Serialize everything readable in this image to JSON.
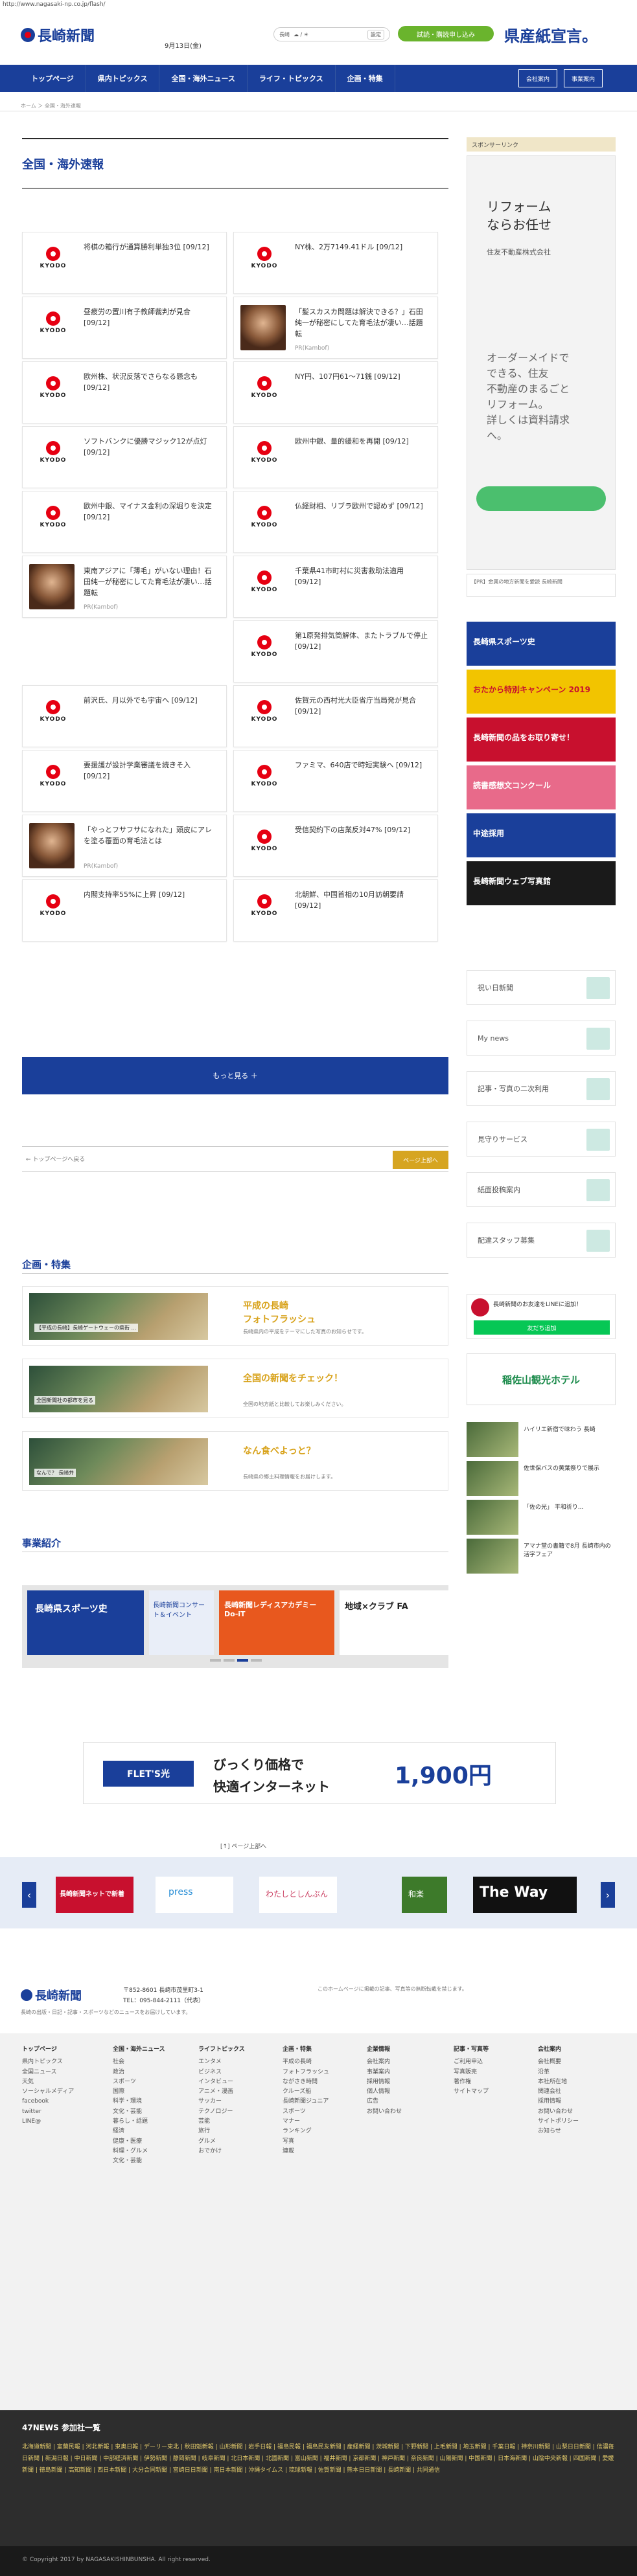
{
  "browser": {
    "url": "http://www.nagasaki-np.co.jp/flash/"
  },
  "header": {
    "logo_text": "長崎新聞",
    "date": "9月13日(金)",
    "weather": "長崎",
    "weather_btn": "設定",
    "trial_btn": "試読・購読申し込み",
    "ken": "県産紙宣言。"
  },
  "nav": {
    "items": [
      "トップページ",
      "県内トピックス",
      "全国・海外ニュース",
      "ライフ・トピックス",
      "企画・特集"
    ],
    "right": [
      "会社案内",
      "事業案内"
    ]
  },
  "breadcrumb": "ホーム ＞ 全国・海外速報",
  "page_title": "全国・海外速報",
  "cards": [
    {
      "text": "将棋の箱行が通算勝利単独3位 [09/12]",
      "type": "kyodo"
    },
    {
      "text": "NY株、2万7149.41ドル [09/12]",
      "type": "kyodo"
    },
    {
      "text": "昼疲労の置川有子教師裁判が見合 [09/12]",
      "type": "kyodo"
    },
    {
      "text": "「髪スカスカ問題は解決できる？」石田純一が秘密にしてた育毛法が凄い…話題転",
      "type": "photo",
      "pr": "PR(Kambof)"
    },
    {
      "text": "欧州株、状況反落でさらなる懸念も [09/12]",
      "type": "kyodo"
    },
    {
      "text": "NY円、107円61〜71銭 [09/12]",
      "type": "kyodo"
    },
    {
      "text": "ソフトバンクに優勝マジック12が点灯 [09/12]",
      "type": "kyodo"
    },
    {
      "text": "欧州中銀、量的緩和を再開 [09/12]",
      "type": "kyodo"
    },
    {
      "text": "欧州中銀、マイナス金利の深堀りを決定 [09/12]",
      "type": "kyodo"
    },
    {
      "text": "仏経財相、リブラ欧州で認めず [09/12]",
      "type": "kyodo"
    },
    {
      "text": "東南アジアに「薄毛」がいない理由！石田純一が秘密にしてた育毛法が凄い…話題転",
      "type": "photo",
      "pr": "PR(Kambof)"
    },
    {
      "text": "千葉県41市町村に災害救助法適用 [09/12]",
      "type": "kyodo"
    },
    {
      "text": "",
      "type": "empty"
    },
    {
      "text": "第1原発排気筒解体、またトラブルで停止 [09/12]",
      "type": "kyodo"
    },
    {
      "text": "前沢氏、月以外でも宇宙へ [09/12]",
      "type": "kyodo"
    },
    {
      "text": "佐賀元の西村光大臣省庁当局発が見合 [09/12]",
      "type": "kyodo"
    },
    {
      "text": "要援護が設計学業審議を続きそ入 [09/12]",
      "type": "kyodo"
    },
    {
      "text": "ファミマ、640店で時短実験へ [09/12]",
      "type": "kyodo"
    },
    {
      "text": "「やっとフサフサになれた」頭皮にアレを塗る覆面の育毛法とは",
      "type": "photo",
      "pr": "PR(Kambof)"
    },
    {
      "text": "受信契約下の店業反対47% [09/12]",
      "type": "kyodo"
    },
    {
      "text": "内閣支持率55%に上昇 [09/12]",
      "type": "kyodo"
    },
    {
      "text": "北朝鮮、中国首相の10月訪朝要請 [09/12]",
      "type": "kyodo"
    }
  ],
  "kyodo_label": "KYODO",
  "more_button": "もっと見る ＋",
  "pager": {
    "back": "← トップページへ戻る",
    "top": "ページ上部へ"
  },
  "tokushu": {
    "title": "企画・特集",
    "items": [
      {
        "caption": "【平成の長崎】長崎ゲートウェーの県街 ...",
        "head": "平成の長崎\nフォトフラッシュ",
        "desc": "長崎県内の平成をテーマにした写真のお知らせです。"
      },
      {
        "caption": "全国新聞社の都市を見る",
        "head": "全国の新聞をチェック！",
        "desc": "全国の地方紙と比較してお楽しみください。"
      },
      {
        "caption": "なんで？ 長崎弁",
        "head": "なん食べよっと？",
        "desc": "長崎県の郷土料理情報をお届けします。"
      }
    ]
  },
  "jigyo": {
    "title": "事業紹介",
    "banners": [
      "長崎県スポーツ史",
      "長崎新聞コンサート＆イベント",
      "長崎新聞レディスアカデミー Do-iT",
      "地域×クラブ FA"
    ]
  },
  "ad_banner": {
    "left": "FLET'S光",
    "right_1": "びっくり価格で",
    "right_2": "快適インターネット",
    "price": "1,900円"
  },
  "fix_label": "[↑] ページ上部へ",
  "strip_banners": [
    "長崎新聞ネットで新着",
    "press",
    "わたしとしんぶん",
    "和楽",
    "The Way"
  ],
  "footer": {
    "address": "〒852-8601 長崎市茂里町3-1",
    "tel": "TEL：095-844-2111（代表）",
    "note": "長崎の出版・日記・記事・スポーツなどのニュースをお届けしています。",
    "policy": "このホームページに掲載の記事、写真等の無断転載を禁じます。",
    "cols": [
      {
        "head": "トップページ",
        "items": [
          "県内トピックス",
          "全国ニュース",
          "天気",
          "ソーシャルメディア",
          "facebook",
          "twitter",
          "LINE@"
        ]
      },
      {
        "head": "全国・海外ニュース",
        "items": [
          "社会",
          "政治",
          "スポーツ",
          "国際",
          "科学・環境",
          "文化・芸能",
          "暮らし・話題",
          "経済",
          "健康・医療",
          "料理・グルメ",
          "文化・芸能"
        ]
      },
      {
        "head": "ライフトピックス",
        "items": [
          "エンタメ",
          "ビジネス",
          "インタビュー",
          "アニメ・漫画",
          "サッカー",
          "テクノロジー",
          "芸能",
          "旅行",
          "グルメ",
          "おでかけ"
        ]
      },
      {
        "head": "企画・特集",
        "items": [
          "平成の長崎",
          "フォトフラッシュ",
          "ながさき時間",
          "クルーズ船",
          "長崎新聞ジュニア",
          "スポーツ",
          "マナー",
          "ランキング",
          "写真",
          "連載"
        ]
      },
      {
        "head": "企業情報",
        "items": [
          "会社案内",
          "事業案内",
          "採用情報",
          "個人情報",
          "広告",
          "お問い合わせ"
        ]
      },
      {
        "head": "記事・写真等",
        "items": [
          "ご利用申込",
          "写真販売",
          "著作権",
          "サイトマップ"
        ]
      },
      {
        "head": "会社案内",
        "items": [
          "会社概要",
          "沿革",
          "本社所在地",
          "関連会社",
          "採用情報",
          "お問い合わせ",
          "サイトポリシー",
          "お知らせ"
        ]
      }
    ]
  },
  "n47": {
    "title": "47NEWS 参加社一覧",
    "links": "北海道新聞 | 室蘭民報 | 河北新報 | 東奥日報 | デーリー東北 | 秋田魁新報 | 山形新聞 | 岩手日報 | 福島民報 | 福島民友新聞 | 産経新聞 | 茨城新聞 | 下野新聞 | 上毛新聞 | 埼玉新聞 | 千葉日報 | 神奈川新聞 | 山梨日日新聞 | 信濃毎日新聞 | 新潟日報 | 中日新聞 | 中部経済新聞 | 伊勢新聞 | 静岡新聞 | 岐阜新聞 | 北日本新聞 | 北國新聞 | 富山新聞 | 福井新聞 | 京都新聞 | 神戸新聞 | 奈良新聞 | 山陽新聞 | 中国新聞 | 日本海新聞 | 山陰中央新報 | 四国新聞 | 愛媛新聞 | 徳島新聞 | 高知新聞 | 西日本新聞 | 大分合同新聞 | 宮崎日日新聞 | 南日本新聞 | 沖縄タイムス | 琉球新報 | 佐賀新聞 | 熊本日日新聞 | 長崎新聞 | 共同通信"
  },
  "copyright": "© Copyright 2017 by NAGASAKISHINBUNSHA. All right reserved.",
  "sidebar": {
    "sponsor": "スポンサーリンク",
    "ad_line1": "リフォーム",
    "ad_line2": "ならお任せ",
    "ad_line3": "住友不動産株式会社",
    "ad_line4": "オーダーメイドで\nできる、住友\n不動産のまるごと\nリフォーム。\n詳しくは資料請求\nへ。",
    "ad_foot": "【PR】金属の地方新聞を愛読 長崎新聞",
    "banners": [
      "長崎県スポーツ史",
      "おたから特別キャンペーン 2019",
      "長崎新聞の品をお取り寄せ！",
      "読書感想文コンクール",
      "中途採用",
      "長崎新聞ウェブ写真館"
    ],
    "links": [
      "祝い日新聞",
      "My news",
      "記事・写真の二次利用",
      "見守りサービス",
      "紙面投稿案内",
      "配達スタッフ募集"
    ],
    "line_title": "長崎新聞のお友達をLINEに追加！",
    "line_btn": "友だち追加",
    "hotel": "稲佐山観光ホテル",
    "news": [
      {
        "t": "ハイリエ新宿で味わう 長崎"
      },
      {
        "t": "佐世保バスの黄葉祭りで展示"
      },
      {
        "t": "「佐の光」 平和祈り..."
      },
      {
        "t": "アマナ堂の書籍で8月 長崎市内の活字フェア"
      }
    ]
  }
}
